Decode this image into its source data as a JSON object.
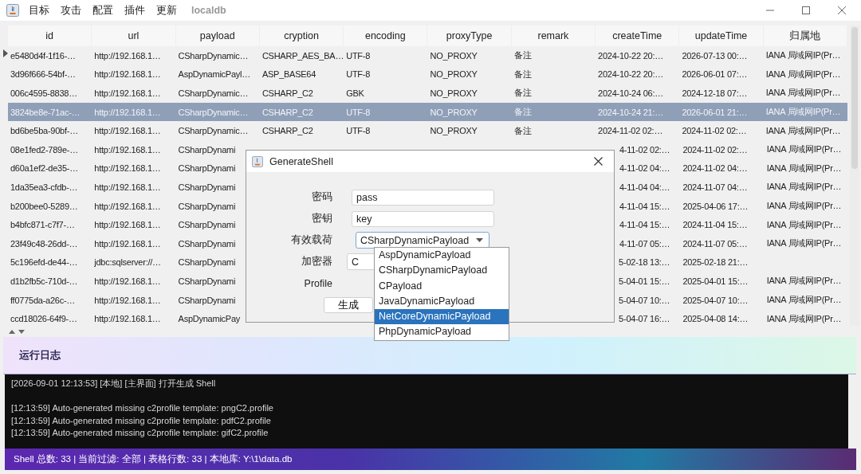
{
  "menu": {
    "items": [
      "目标",
      "攻击",
      "配置",
      "插件",
      "更新"
    ],
    "db_label": "localdb"
  },
  "table": {
    "columns": [
      "id",
      "url",
      "payload",
      "cryption",
      "encoding",
      "proxyType",
      "remark",
      "createTime",
      "updateTime",
      "归属地"
    ],
    "rows": [
      {
        "selected": false,
        "cells": [
          "e5480d4f-1f16-…",
          "http://192.168.1…",
          "CSharpDynamic…",
          "CSHARP_AES_BA…",
          "UTF-8",
          "NO_PROXY",
          "备注",
          "2024-10-22 20:…",
          "2026-07-13 00:…",
          "IANA 局域网IP(Pr…"
        ]
      },
      {
        "selected": false,
        "cells": [
          "3d96f666-54bf-…",
          "http://192.168.1…",
          "AspDynamicPayl…",
          "ASP_BASE64",
          "UTF-8",
          "NO_PROXY",
          "备注",
          "2024-10-22 20:…",
          "2026-06-01 07:…",
          "IANA 局域网IP(Pr…"
        ]
      },
      {
        "selected": false,
        "cells": [
          "006c4595-8838…",
          "http://192.168.1…",
          "CSharpDynamic…",
          "CSHARP_C2",
          "GBK",
          "NO_PROXY",
          "备注",
          "2024-10-24 06:…",
          "2024-12-18 07:…",
          "IANA 局域网IP(Pr…"
        ]
      },
      {
        "selected": true,
        "cells": [
          "3824be8e-71ac-…",
          "http://192.168.1…",
          "CSharpDynamic…",
          "CSHARP_C2",
          "UTF-8",
          "NO_PROXY",
          "备注",
          "2024-10-24 21:…",
          "2026-06-01 21:…",
          "IANA 局域网IP(Pr…"
        ]
      },
      {
        "selected": false,
        "cells": [
          "bd6be5ba-90bf-…",
          "http://192.168.1…",
          "CSharpDynamic…",
          "CSHARP_C2",
          "UTF-8",
          "NO_PROXY",
          "备注",
          "2024-11-02 02:…",
          "2024-11-02 02:…",
          "IANA 局域网IP(Pr…"
        ]
      },
      {
        "selected": false,
        "cells_left": [
          "08e1fed2-789e-…",
          "http://192.168.1…",
          "CSharpDynami"
        ],
        "cells_right": [
          "4-11-02 02:…",
          "2024-11-02 02:…",
          "IANA 局域网IP(Pr…"
        ]
      },
      {
        "selected": false,
        "cells_left": [
          "d60a1ef2-de35-…",
          "http://192.168.1…",
          "CSharpDynami"
        ],
        "cells_right": [
          "4-11-02 04:…",
          "2024-11-02 04:…",
          "IANA 局域网IP(Pr…"
        ]
      },
      {
        "selected": false,
        "cells_left": [
          "1da35ea3-cfdb-…",
          "http://192.168.1…",
          "CSharpDynami"
        ],
        "cells_right": [
          "4-11-04 04:…",
          "2024-11-07 04:…",
          "IANA 局域网IP(Pr…"
        ]
      },
      {
        "selected": false,
        "cells_left": [
          "b200bee0-5289…",
          "http://192.168.1…",
          "CSharpDynami"
        ],
        "cells_right": [
          "4-11-04 15:…",
          "2025-04-06 17:…",
          "IANA 局域网IP(Pr…"
        ]
      },
      {
        "selected": false,
        "cells_left": [
          "b4bfc871-c7f7-…",
          "http://192.168.1…",
          "CSharpDynami"
        ],
        "cells_right": [
          "4-11-04 15:…",
          "2024-11-04 15:…",
          "IANA 局域网IP(Pr…"
        ]
      },
      {
        "selected": false,
        "cells_left": [
          "23f49c48-26dd-…",
          "http://192.168.1…",
          "CSharpDynami"
        ],
        "cells_right": [
          "4-11-07 05:…",
          "2024-11-07 05:…",
          "IANA 局域网IP(Pr…"
        ]
      },
      {
        "selected": false,
        "cells_left": [
          "5c196efd-de44-…",
          "jdbc:sqlserver://…",
          "CSharpDynami"
        ],
        "cells_right": [
          "5-02-18 13:…",
          "2025-02-18 21:…"
        ]
      },
      {
        "selected": false,
        "cells_left": [
          "d1b2fb5c-710d-…",
          "http://192.168.1…",
          "CSharpDynami"
        ],
        "cells_right": [
          "5-04-01 15:…",
          "2025-04-01 15:…",
          "IANA 局域网IP(Pr…"
        ]
      },
      {
        "selected": false,
        "cells_left": [
          "ff0775da-a26c-…",
          "http://192.168.1…",
          "CSharpDynami"
        ],
        "cells_right": [
          "5-04-07 10:…",
          "2025-04-07 10:…",
          "IANA 局域网IP(Pr…"
        ]
      },
      {
        "selected": false,
        "cells_left": [
          "ccd18026-64f9-…",
          "http://192.168.1…",
          "AspDynamicPay"
        ],
        "cells_right": [
          "5-04-07 16:…",
          "2025-04-08 14:…",
          "IANA 局域网IP(Pr…"
        ]
      }
    ]
  },
  "log": {
    "title": "运行日志",
    "groups": [
      [
        "[2026-09-01 12:13:53] [本地] [主界面] 打开生成 Shell"
      ],
      [
        "[12:13:59] Auto-generated missing c2profile template: pngC2.profile",
        "[12:13:59] Auto-generated missing c2profile template: pdfC2.profile",
        "[12:13:59] Auto-generated missing c2profile template: gifC2.profile"
      ]
    ]
  },
  "status_bar": "Shell 总数: 33 | 当前过滤: 全部 | 表格行数: 33 | 本地库: Y:\\1\\data.db",
  "dialog": {
    "title": "GenerateShell",
    "fields": [
      {
        "kind": "text",
        "label": "密码",
        "value": "pass"
      },
      {
        "kind": "text",
        "label": "密钥",
        "value": "key"
      },
      {
        "kind": "combo",
        "label": "有效载荷",
        "value": "CSharpDynamicPayload"
      },
      {
        "kind": "combo",
        "label": "加密器",
        "value": "C"
      },
      {
        "kind": "none",
        "label": "Profile"
      }
    ],
    "button": "生成",
    "dropdown": [
      {
        "label": "AspDynamicPayload",
        "selected": false
      },
      {
        "label": "CSharpDynamicPayload",
        "selected": false
      },
      {
        "label": "CPayload",
        "selected": false
      },
      {
        "label": "JavaDynamicPayload",
        "selected": false
      },
      {
        "label": "NetCoreDynamicPayload",
        "selected": true
      },
      {
        "label": "PhpDynamicPayload",
        "selected": false
      }
    ]
  }
}
